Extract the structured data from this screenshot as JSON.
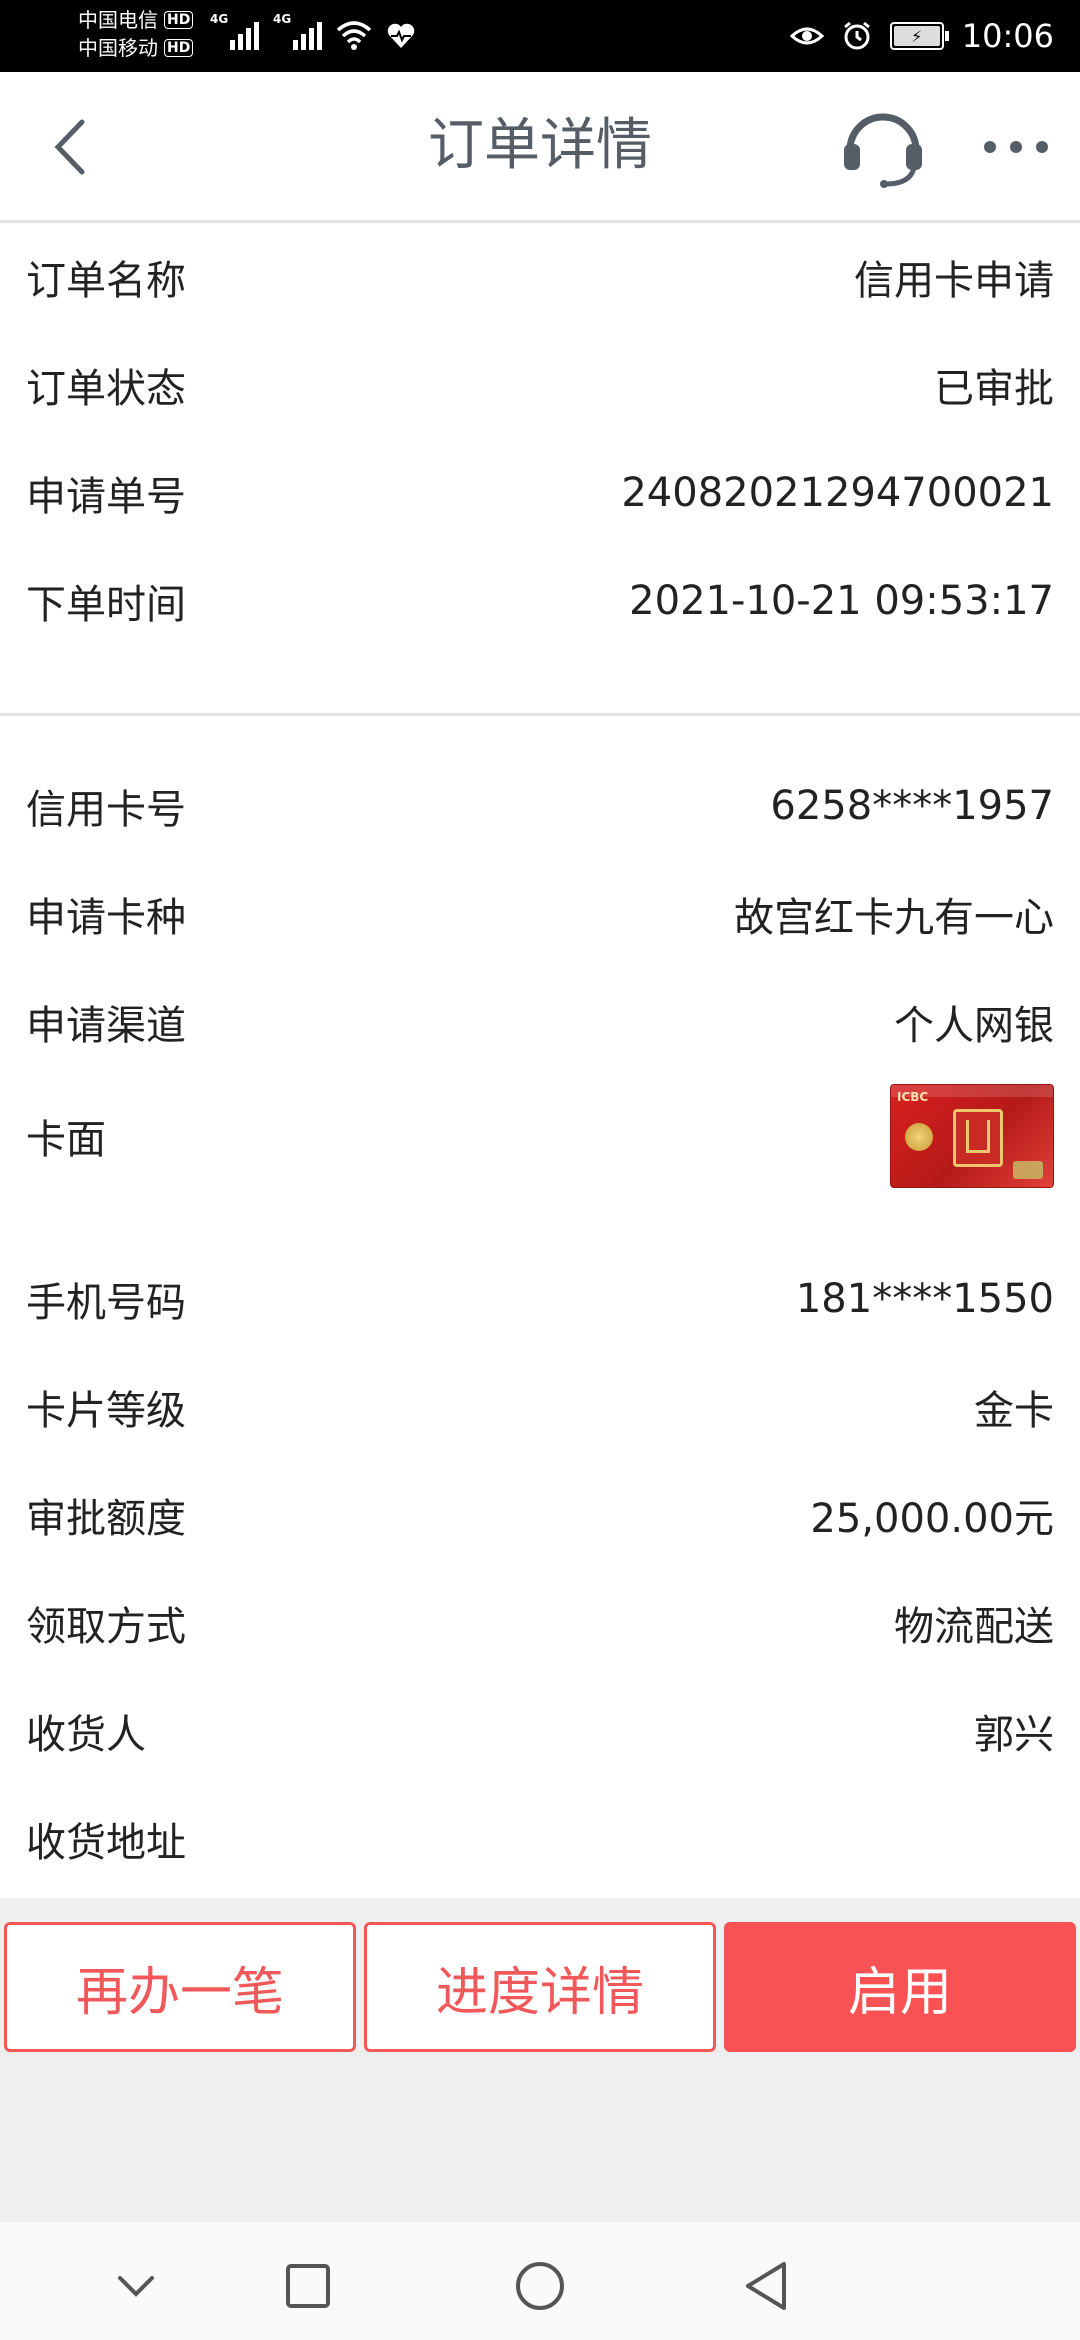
{
  "status_bar": {
    "carrier1": "中国电信",
    "carrier2": "中国移动",
    "hd": "HD",
    "network_type": "4G",
    "time": "10:06",
    "icons": [
      "signal-icon",
      "wifi-icon",
      "health-icon",
      "eye-icon",
      "alarm-icon",
      "battery-icon"
    ]
  },
  "nav": {
    "title": "订单详情",
    "icons": [
      "back-icon",
      "customer-service-icon",
      "more-icon"
    ]
  },
  "order_info": [
    {
      "label": "订单名称",
      "value": "信用卡申请"
    },
    {
      "label": "订单状态",
      "value": "已审批"
    },
    {
      "label": "申请单号",
      "value": "24082021294700021"
    },
    {
      "label": "下单时间",
      "value": "2021-10-21 09:53:17"
    }
  ],
  "card_info": [
    {
      "label": "信用卡号",
      "value": "6258****1957"
    },
    {
      "label": "申请卡种",
      "value": "故宫红卡九有一心"
    },
    {
      "label": "申请渠道",
      "value": "个人网银"
    },
    {
      "label": "卡面",
      "value": ""
    },
    {
      "label": "手机号码",
      "value": "181****1550"
    },
    {
      "label": "卡片等级",
      "value": "金卡"
    },
    {
      "label": "审批额度",
      "value": "25,000.00元"
    },
    {
      "label": "领取方式",
      "value": "物流配送"
    },
    {
      "label": "收货人",
      "value": "郭兴"
    },
    {
      "label": "收货地址",
      "value": ""
    }
  ],
  "card_image": {
    "logo_text": "ICBC",
    "colors": {
      "main": "#d8201f",
      "gold": "#f0c66b"
    }
  },
  "buttons": {
    "reapply": "再办一笔",
    "progress": "进度详情",
    "activate": "启用"
  },
  "colors": {
    "accent": "#f85255",
    "title": "#555d66",
    "background": "#efefef"
  },
  "system_nav": [
    "collapse-icon",
    "recents-icon",
    "home-icon",
    "back-nav-icon"
  ]
}
